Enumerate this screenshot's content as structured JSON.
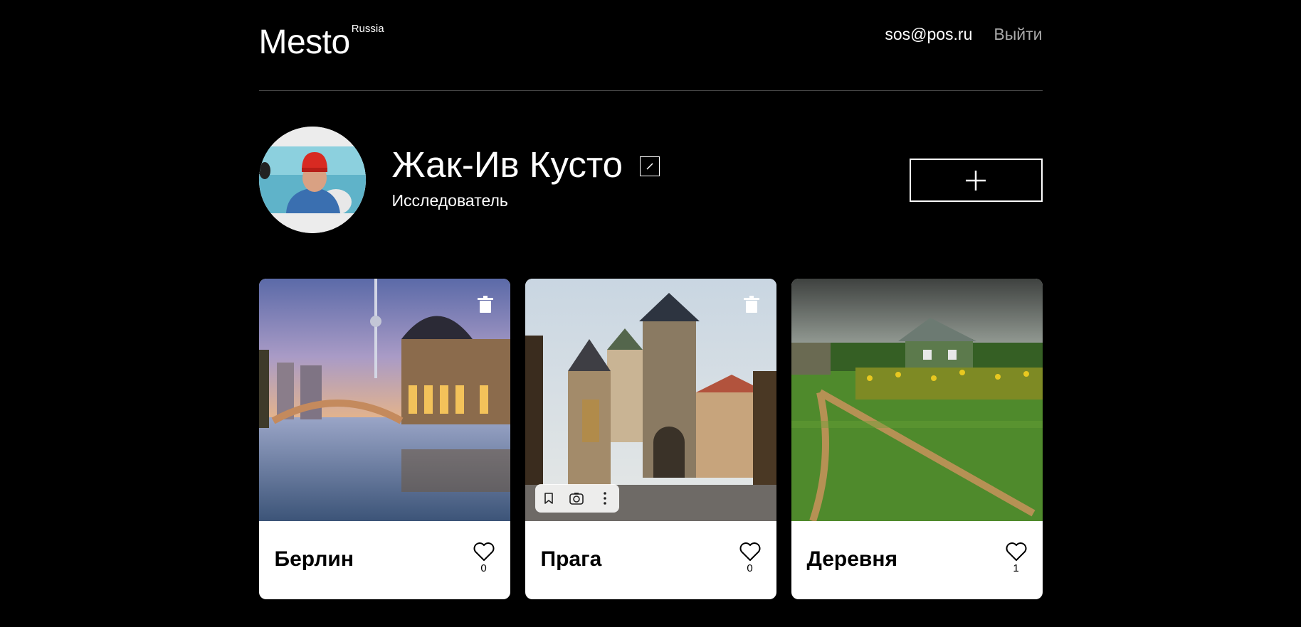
{
  "header": {
    "logo": "Mesto",
    "logo_sup": "Russia",
    "email": "sos@pos.ru",
    "logout": "Выйти"
  },
  "profile": {
    "name": "Жак-Ив Кусто",
    "about": "Исследователь",
    "edit_icon": "pencil-icon",
    "add_icon": "plus-icon"
  },
  "cards": [
    {
      "title": "Берлин",
      "likes": "0",
      "deletable": true
    },
    {
      "title": "Прага",
      "likes": "0",
      "deletable": true
    },
    {
      "title": "Деревня",
      "likes": "1",
      "deletable": false
    }
  ],
  "colors": {
    "background": "#000000",
    "card": "#ffffff",
    "muted_link": "#a9a9a9"
  }
}
